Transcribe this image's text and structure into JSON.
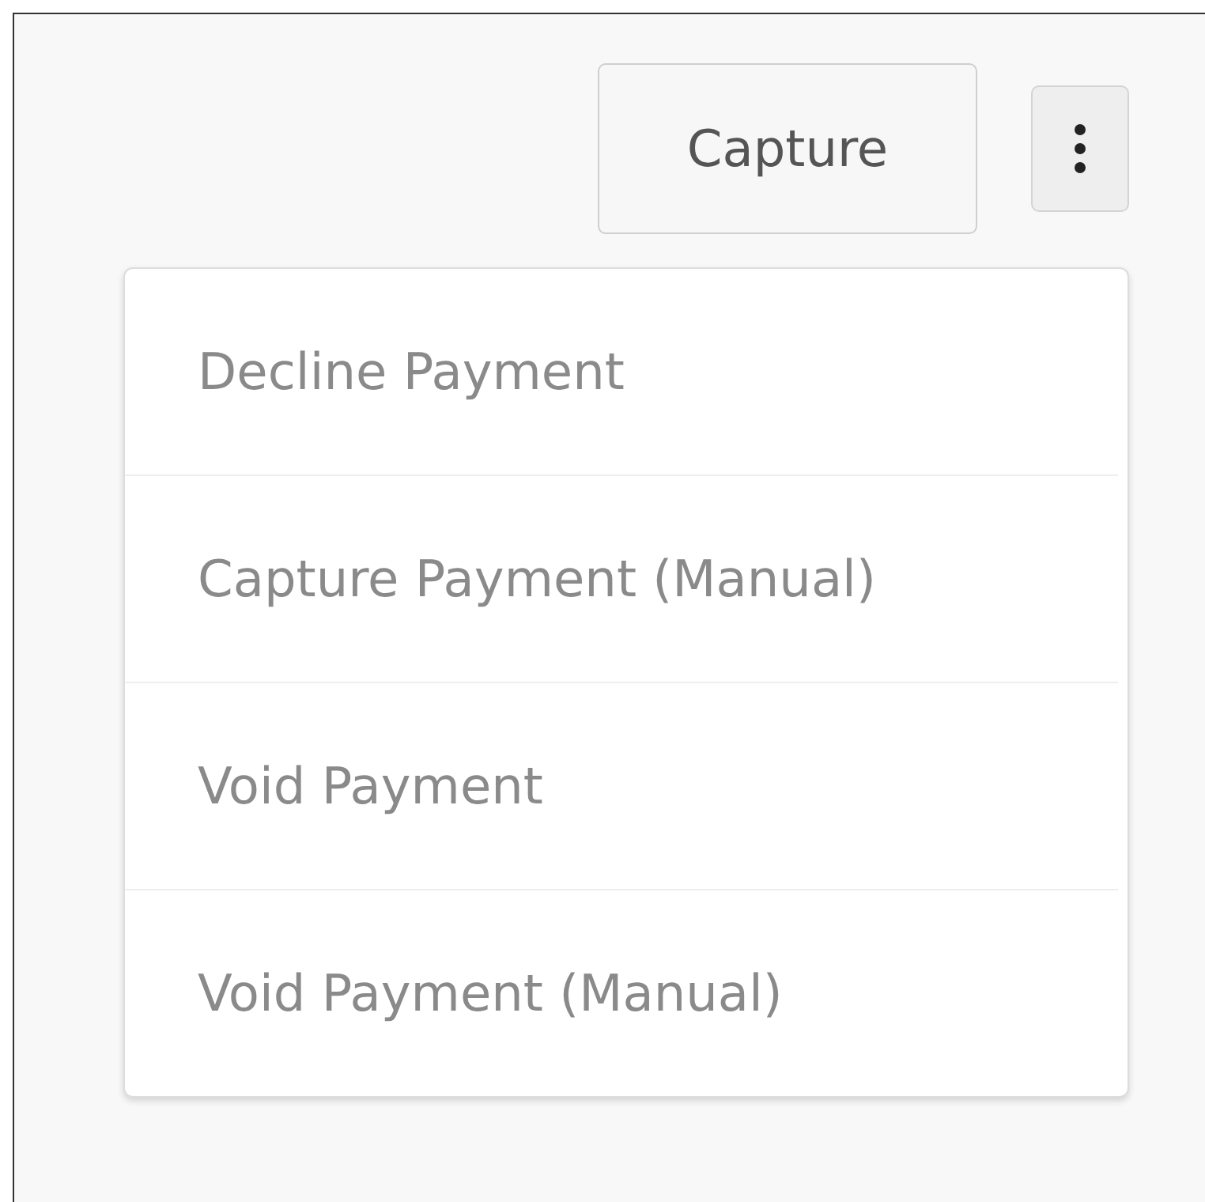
{
  "actions": {
    "primary_button": "Capture"
  },
  "menu": {
    "items": [
      {
        "label": "Decline Payment"
      },
      {
        "label": "Capture Payment (Manual)"
      },
      {
        "label": "Void Payment"
      },
      {
        "label": "Void Payment (Manual)"
      }
    ]
  }
}
